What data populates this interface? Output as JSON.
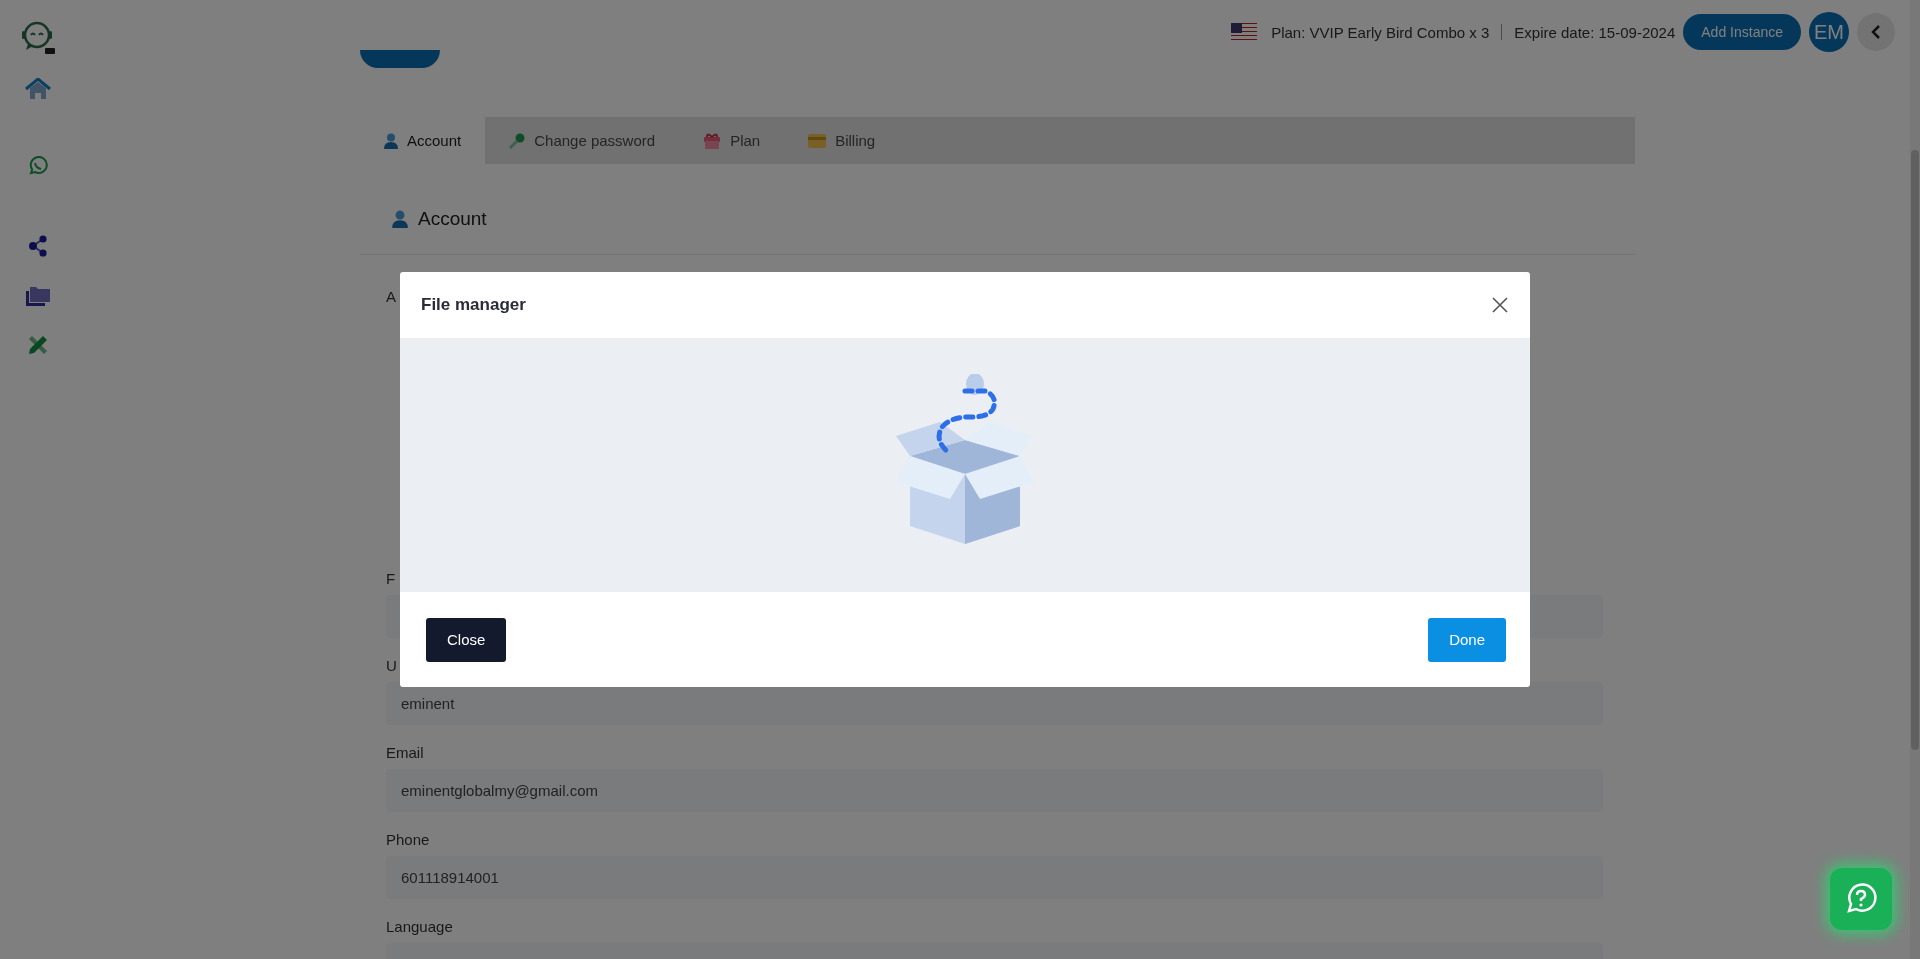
{
  "top_bar": {
    "plan": "Plan: VVIP Early Bird Combo x 3",
    "expire": "Expire date: 15-09-2024",
    "add_button": "Add Instance",
    "avatar": "EM"
  },
  "tabs": [
    {
      "label": "Account",
      "kind": "user",
      "selected": true
    },
    {
      "label": "Change password",
      "kind": "key",
      "selected": false
    },
    {
      "label": "Plan",
      "kind": "gift",
      "selected": false
    },
    {
      "label": "Billing",
      "kind": "card",
      "selected": false
    }
  ],
  "section_title": "Account",
  "form": {
    "fields": [
      {
        "label": "A",
        "kind": "upload"
      },
      {
        "label": "F",
        "kind": "text"
      },
      {
        "label": "U",
        "kind": "text",
        "value": "eminent"
      },
      {
        "label": "Email",
        "kind": "text",
        "value": "eminentglobalmy@gmail.com"
      },
      {
        "label": "Phone",
        "kind": "text",
        "value": "601118914001"
      },
      {
        "label": "Language",
        "kind": "text"
      }
    ]
  },
  "modal": {
    "title": "File manager",
    "close_button": "Close",
    "done_button": "Done"
  }
}
